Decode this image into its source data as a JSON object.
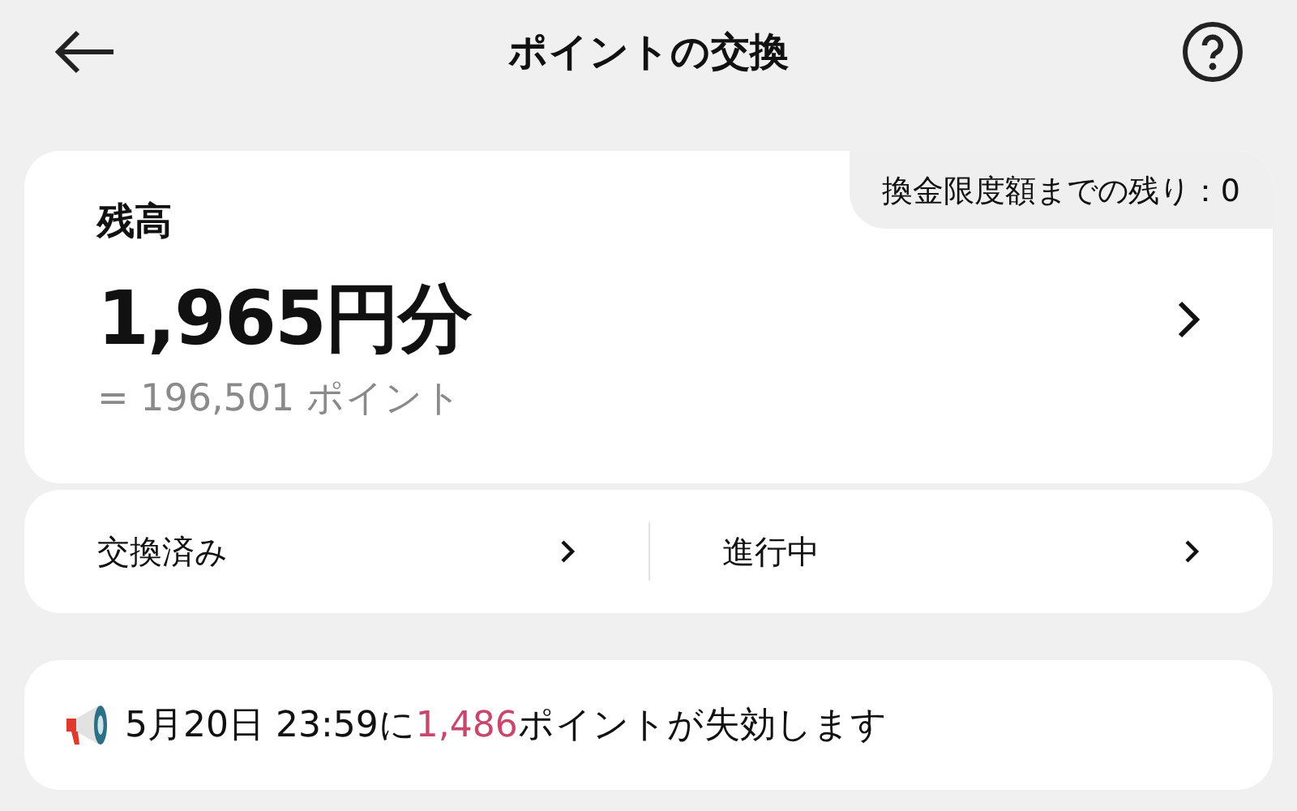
{
  "header": {
    "title": "ポイントの交換"
  },
  "balance": {
    "label": "残高",
    "limit_text": "換金限度額までの残り：0",
    "amount": "1,965円分",
    "points": "= 196,501 ポイント"
  },
  "links": [
    {
      "label": "交換済み"
    },
    {
      "label": "進行中"
    }
  ],
  "notice": {
    "before": "5月20日 23:59に",
    "highlight": "1,486",
    "after": "ポイントが失効します"
  }
}
